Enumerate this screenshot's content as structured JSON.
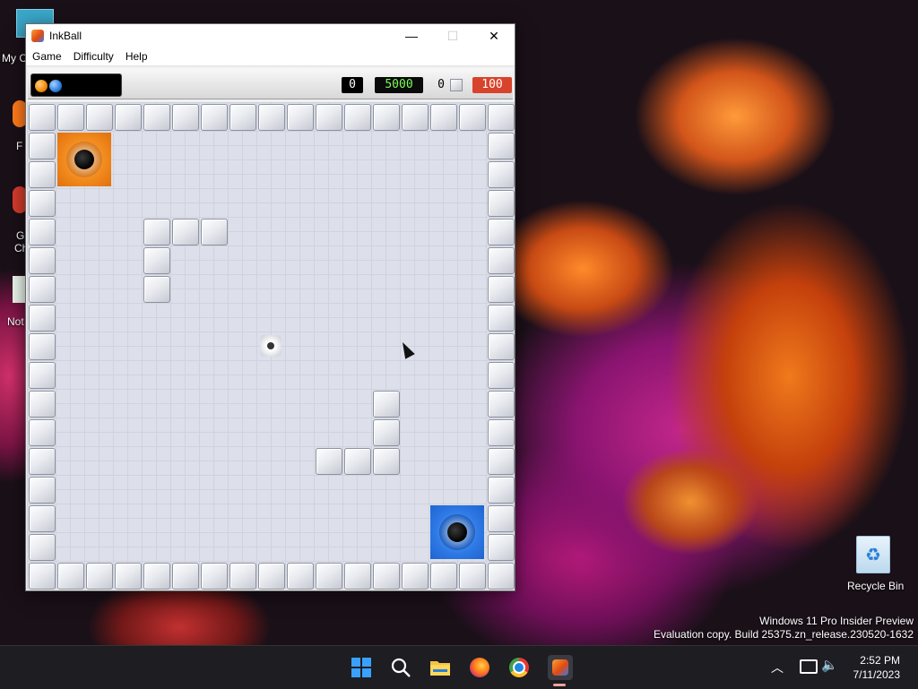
{
  "desktop": {
    "icons": [
      {
        "label": "My C"
      },
      {
        "label": "F"
      },
      {
        "label": "G\nCh"
      },
      {
        "label": "Not"
      }
    ],
    "recycle_bin": "Recycle Bin",
    "watermark_line1": "Windows 11 Pro Insider Preview",
    "watermark_line2": "Evaluation copy. Build 25375.zn_release.230520-1632"
  },
  "window": {
    "title": "InkBall",
    "minimize": "—",
    "maximize": "☐",
    "close": "✕"
  },
  "menu": {
    "game": "Game",
    "difficulty": "Difficulty",
    "help": "Help"
  },
  "status": {
    "score": "0",
    "time_limit": "5000",
    "balls_remaining": "0",
    "time_counter": "100",
    "colors": {
      "score_bg": "#000000",
      "score_fg": "#ffffff",
      "limit_fg": "#7cff5a",
      "counter_bg": "#d8432c"
    }
  },
  "board": {
    "cols": 17,
    "rows": 17,
    "holes": [
      {
        "color": "orange",
        "col": 1,
        "row": 1
      },
      {
        "color": "blue",
        "col": 14,
        "row": 14
      }
    ],
    "spawner": {
      "col": 8,
      "row": 8
    },
    "inner_blocks": [
      [
        4,
        4
      ],
      [
        5,
        4
      ],
      [
        6,
        4
      ],
      [
        4,
        5
      ],
      [
        4,
        6
      ],
      [
        12,
        10
      ],
      [
        12,
        11
      ],
      [
        10,
        12
      ],
      [
        11,
        12
      ],
      [
        12,
        12
      ]
    ]
  },
  "taskbar": {
    "icons": [
      "windows-start-icon",
      "search-icon",
      "file-explorer-icon",
      "firefox-icon",
      "chrome-icon",
      "inkball-icon"
    ],
    "tray_icons": [
      "chevron-up-icon",
      "network-icon",
      "volume-icon"
    ],
    "time": "2:52 PM",
    "date": "7/11/2023"
  }
}
